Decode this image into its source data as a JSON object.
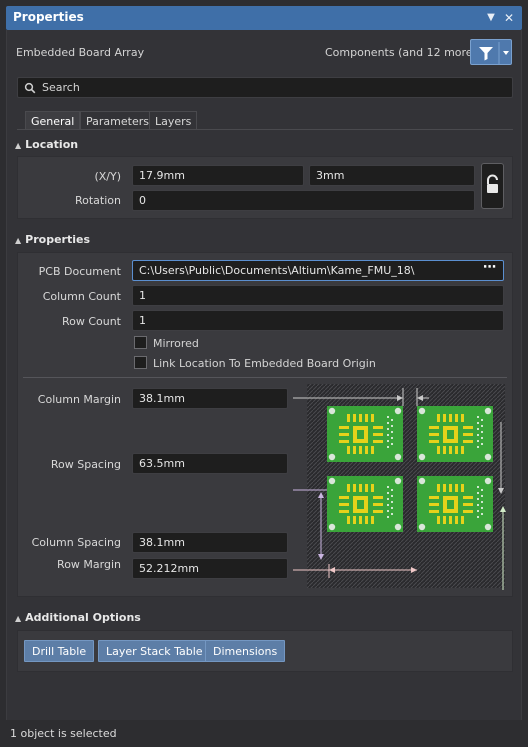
{
  "window": {
    "title": "Properties"
  },
  "header": {
    "object_type": "Embedded Board Array",
    "filter_label": "Components (and 12 more)"
  },
  "search": {
    "placeholder": "Search"
  },
  "tabs": [
    {
      "label": "General",
      "selected": true
    },
    {
      "label": "Parameters",
      "selected": false
    },
    {
      "label": "Layers",
      "selected": false
    }
  ],
  "location": {
    "heading": "Location",
    "xy_label": "(X/Y)",
    "x_value": "17.9mm",
    "y_value": "3mm",
    "rotation_label": "Rotation",
    "rotation_value": "0"
  },
  "properties": {
    "heading": "Properties",
    "pcb_document_label": "PCB Document",
    "pcb_document_value": "C:\\Users\\Public\\Documents\\Altium\\Kame_FMU_18\\",
    "column_count_label": "Column Count",
    "column_count_value": "1",
    "row_count_label": "Row Count",
    "row_count_value": "1",
    "mirrored_label": "Mirrored",
    "mirrored_checked": false,
    "link_label": "Link Location To Embedded Board Origin",
    "link_checked": false,
    "column_margin_label": "Column Margin",
    "column_margin_value": "38.1mm",
    "row_spacing_label": "Row Spacing",
    "row_spacing_value": "63.5mm",
    "column_spacing_label": "Column Spacing",
    "column_spacing_value": "38.1mm",
    "row_margin_label": "Row Margin",
    "row_margin_value": "52.212mm"
  },
  "additional": {
    "heading": "Additional Options",
    "buttons": [
      "Drill Table",
      "Layer Stack Table",
      "Dimensions"
    ]
  },
  "status": {
    "text": "1 object is selected"
  },
  "colors": {
    "title_bar": "#3f6fa8",
    "board_green": "#3aa43a",
    "pad_yellow": "#e6d21a",
    "dimension_line": "#c9c9c9"
  }
}
